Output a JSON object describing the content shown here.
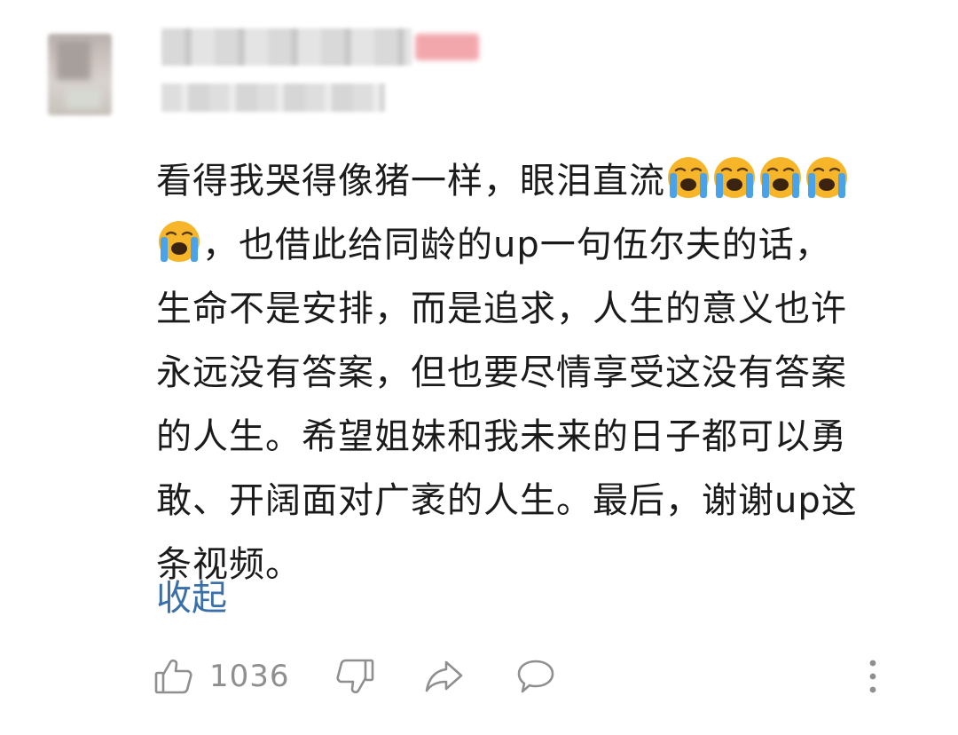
{
  "comment": {
    "lines": [
      "看得我哭得像猪一样，眼泪直流",
      "，也借此给同龄的up一句伍尔夫的话，",
      "生命不是安排，而是追求，人生的意义也许",
      "永远没有答案，但也要尽情享受这没有答案",
      "的人生。希望姐妹和我未来的日子都可以勇",
      "敢、开阔面对广袤的人生。最后，谢谢up这",
      "条视频。"
    ],
    "emoji_icon": "loudly-crying-face-icon",
    "collapse_label": "收起"
  },
  "actions": {
    "like_count": "1036",
    "icons": [
      "thumbs-up-icon",
      "thumbs-down-icon",
      "share-icon",
      "comment-icon",
      "more-vertical-icon"
    ]
  },
  "colors": {
    "text": "#1b1b1b",
    "link": "#3a6fa8",
    "icon": "#8f8f8f",
    "emoji_face": "#f7b52a"
  }
}
